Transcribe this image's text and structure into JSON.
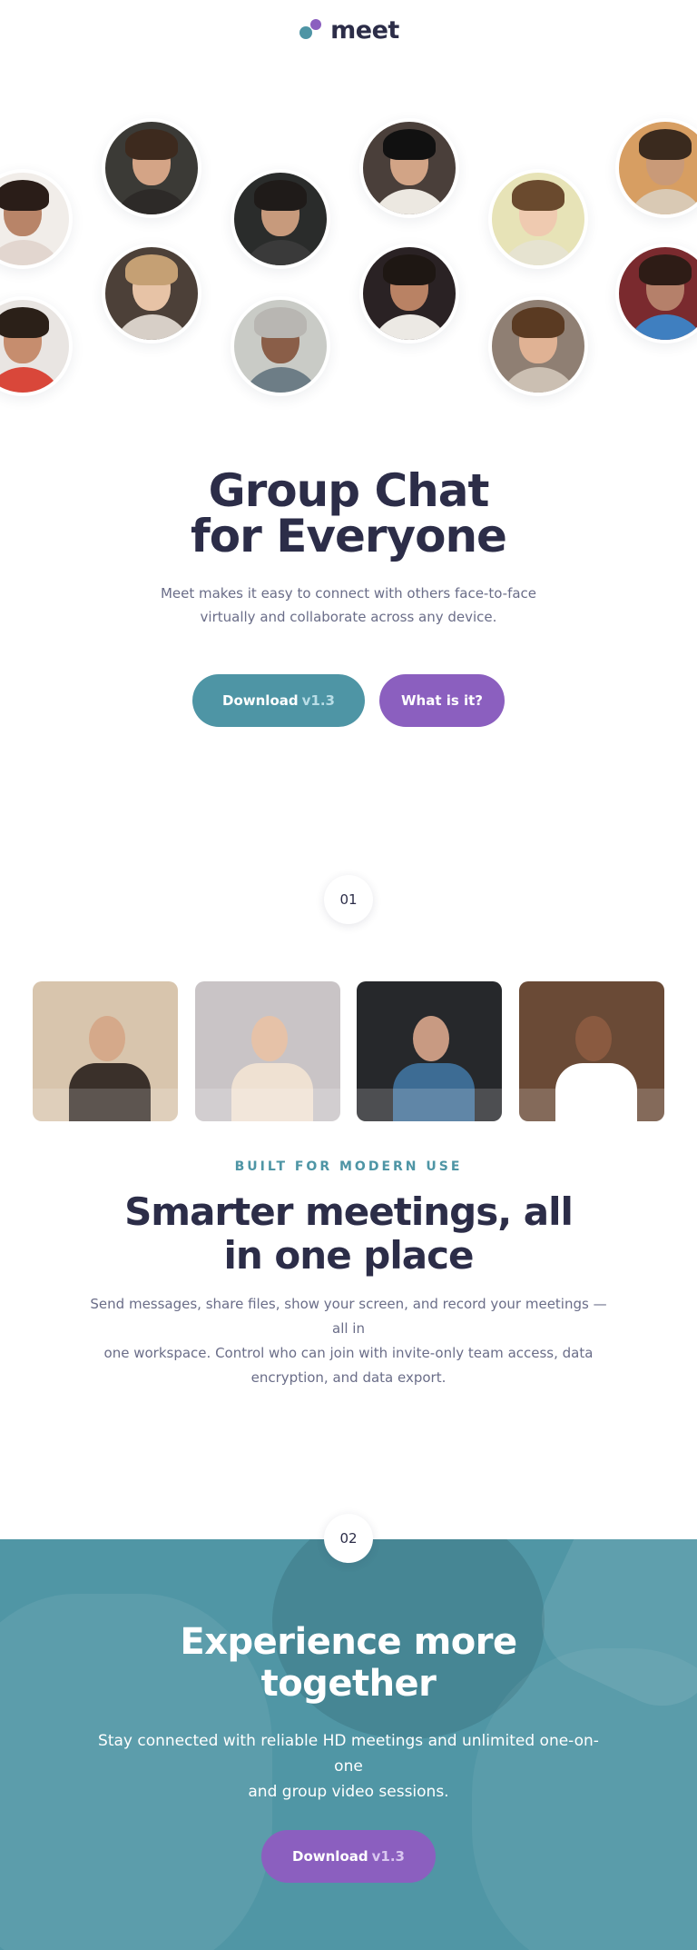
{
  "header": {
    "logo_text": "meet"
  },
  "avatars": [
    {
      "skin": "#b88468",
      "hair": "#2a1d18",
      "shirt": "#e2d6cf",
      "bg": "#f1ede9"
    },
    {
      "skin": "#c68d6e",
      "hair": "#2b2018",
      "shirt": "#d9473a",
      "bg": "#e9e5e2"
    },
    {
      "skin": "#d4a486",
      "hair": "#3d2a1e",
      "shirt": "#2d2a28",
      "bg": "#3b3a36"
    },
    {
      "skin": "#e7c3a6",
      "hair": "#c5a074",
      "shirt": "#d7cfc7",
      "bg": "#4c4038"
    },
    {
      "skin": "#c79a7c",
      "hair": "#1f1b19",
      "shirt": "#3a3a3a",
      "bg": "#2a2c2b"
    },
    {
      "skin": "#8a5e48",
      "hair": "#b8b6b2",
      "shirt": "#6d7d86",
      "bg": "#c9cbc6"
    },
    {
      "skin": "#d2a486",
      "hair": "#111111",
      "shirt": "#ece8e1",
      "bg": "#4a3f3a"
    },
    {
      "skin": "#b98264",
      "hair": "#1e1713",
      "shirt": "#ece9e4",
      "bg": "#2a2224"
    },
    {
      "skin": "#efcab0",
      "hair": "#6a4a2e",
      "shirt": "#e6e3d0",
      "bg": "#e7e3b7"
    },
    {
      "skin": "#e0b294",
      "hair": "#5a3a22",
      "shirt": "#cbbfb2",
      "bg": "#8f7f73"
    },
    {
      "skin": "#c99a78",
      "hair": "#3a2a1e",
      "shirt": "#d9c9b4",
      "bg": "#d79e62"
    },
    {
      "skin": "#b5806a",
      "hair": "#2e1c16",
      "shirt": "#3f7fc0",
      "bg": "#7a2a2e"
    }
  ],
  "hero": {
    "title_line1": "Group Chat",
    "title_line2": "for Everyone",
    "subtitle_line1": "Meet makes it easy to connect with others face-to-face",
    "subtitle_line2": "virtually and collaborate across any device.",
    "download_label": "Download",
    "version": "v1.3",
    "what_label": "What is it?"
  },
  "section1": {
    "step": "01",
    "cards": [
      {
        "bg": "#d8c5ad",
        "accent": "#3a302a",
        "skin": "#d5a98a"
      },
      {
        "bg": "#c9c4c6",
        "accent": "#efe1d2",
        "skin": "#e6c2a8"
      },
      {
        "bg": "#26282b",
        "accent": "#3d6c94",
        "skin": "#c89a82"
      },
      {
        "bg": "#6a4a36",
        "accent": "#ffffff",
        "skin": "#8a5a40"
      }
    ],
    "eyebrow": "BUILT FOR MODERN USE",
    "title_line1": "Smarter meetings, all",
    "title_line2": "in one place",
    "body_line1": "Send messages, share files, show your screen, and record your meetings — all in",
    "body_line2": "one workspace. Control who can join with invite-only team access, data",
    "body_line3": "encryption, and data export."
  },
  "section2": {
    "step": "02",
    "title_line1": "Experience more",
    "title_line2": "together",
    "body_line1": "Stay connected with reliable HD meetings and unlimited one-on-one",
    "body_line2": "and group video sessions.",
    "download_label": "Download",
    "version": "v1.3"
  },
  "colors": {
    "primary": "#4e95a5",
    "accent": "#8b5fbf",
    "heading": "#2c2d48",
    "body": "#6a6d88"
  }
}
